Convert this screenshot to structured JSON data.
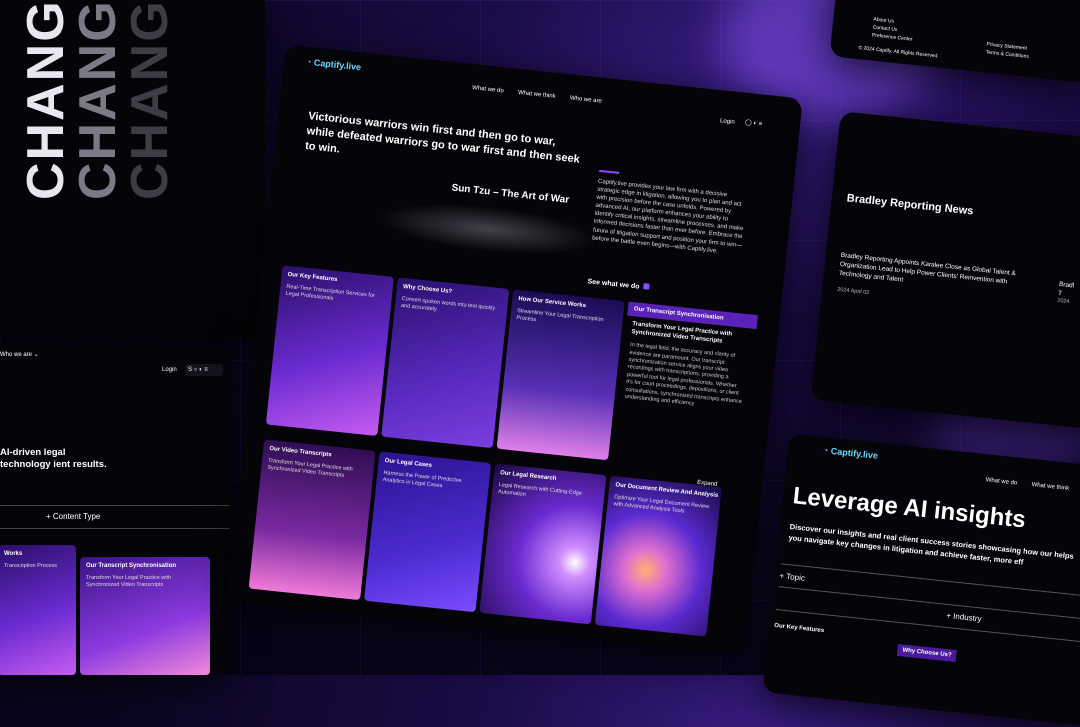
{
  "brand": {
    "name": "Captify.live",
    "accent": "#8a4dff"
  },
  "main": {
    "nav": [
      "What we do",
      "What we think",
      "Who we are"
    ],
    "login": "Login",
    "quote": "Victorious warriors win first and then go to war, while defeated warriors go to war first and then seek to win.",
    "quote_author": "Sun Tzu – The Art of War",
    "intro": "Captify.live provides your law firm with a decisive strategic edge in litigation, allowing you to plan and act with precision before the case unfolds. Powered by advanced AI, our platform enhances your ability to identify critical insights, streamline processes, and make informed decisions faster than ever before. Embrace the future of litigation support and position your firm to win—before the battle even begins—with Captify.live.",
    "cta": "See what we do",
    "expand": "Expand",
    "cards": [
      {
        "title": "Our Key Features",
        "desc": "Real-Time Transcription Services for Legal Professionals"
      },
      {
        "title": "Why Choose Us?",
        "desc": "Convert spoken words into text quickly and accurately."
      },
      {
        "title": "How Our Service Works",
        "desc": "Streamline Your Legal Transcription Process"
      },
      {
        "title": "Our Transcript Synchronisation",
        "desc": "Transform Your Legal Practice with Synchronized Video Transcripts",
        "body": "In the legal field, the accuracy and clarity of evidence are paramount. Our transcript synchronization service aligns your video recordings with transcriptions, providing a powerful tool for legal professionals. Whether it's for court proceedings, depositions, or client consultations, synchronized transcripts enhance understanding and efficiency"
      },
      {
        "title": "Our Video Transcripts",
        "desc": "Transform Your Legal Practice with Synchronized Video Transcripts"
      },
      {
        "title": "Our Legal Cases",
        "desc": "Harness the Power of Predictive Analytics in Legal Cases"
      },
      {
        "title": "Our Legal Research",
        "desc": "Legal Research with Cutting-Edge Automation"
      },
      {
        "title": "Our Document Review And Analysis",
        "desc": "Optimize Your Legal Document Review with Advanced Analysis Tools"
      }
    ]
  },
  "top_left": {
    "word": "CHANGE"
  },
  "mid_left": {
    "nav": "Who we are",
    "login": "Login",
    "headline": "AI-driven legal technology ient results.",
    "filter": "+ Content Type",
    "cards": [
      {
        "title": "Works",
        "desc": "Transcription Process"
      },
      {
        "title": "Our Transcript Synchronisation",
        "desc": "Transform Your Legal Practice with Synchronized Video Transcripts"
      }
    ]
  },
  "top_right": {
    "links_a": [
      "About Us",
      "Contact Us",
      "Preference Center"
    ],
    "links_b": [
      "Privacy Statement",
      "Terms & Conditions"
    ],
    "copyright": "© 2024 Captify. All Rights Reserved."
  },
  "news": {
    "heading": "Bradley Reporting News",
    "item_title": "Bradley Reporting Appoints Karalee Close as Global Talent & Organization Lead to Help Power Clients' Reinvention with Technology and Talent",
    "item_date": "2024 April 02",
    "item2_a": "Bradl",
    "item2_b": "T",
    "item2_date": "2024"
  },
  "bottom_right": {
    "nav": [
      "What we do",
      "What we think"
    ],
    "headline": "Leverage AI insights",
    "sub": "Discover our insights and real client success stories showcasing how our helps you navigate key changes in litigation and achieve faster, more eff",
    "filter_topic": "+ Topic",
    "filter_industry": "+ Industry",
    "card1": "Our Key Features",
    "card2": "Why Choose Us?"
  }
}
